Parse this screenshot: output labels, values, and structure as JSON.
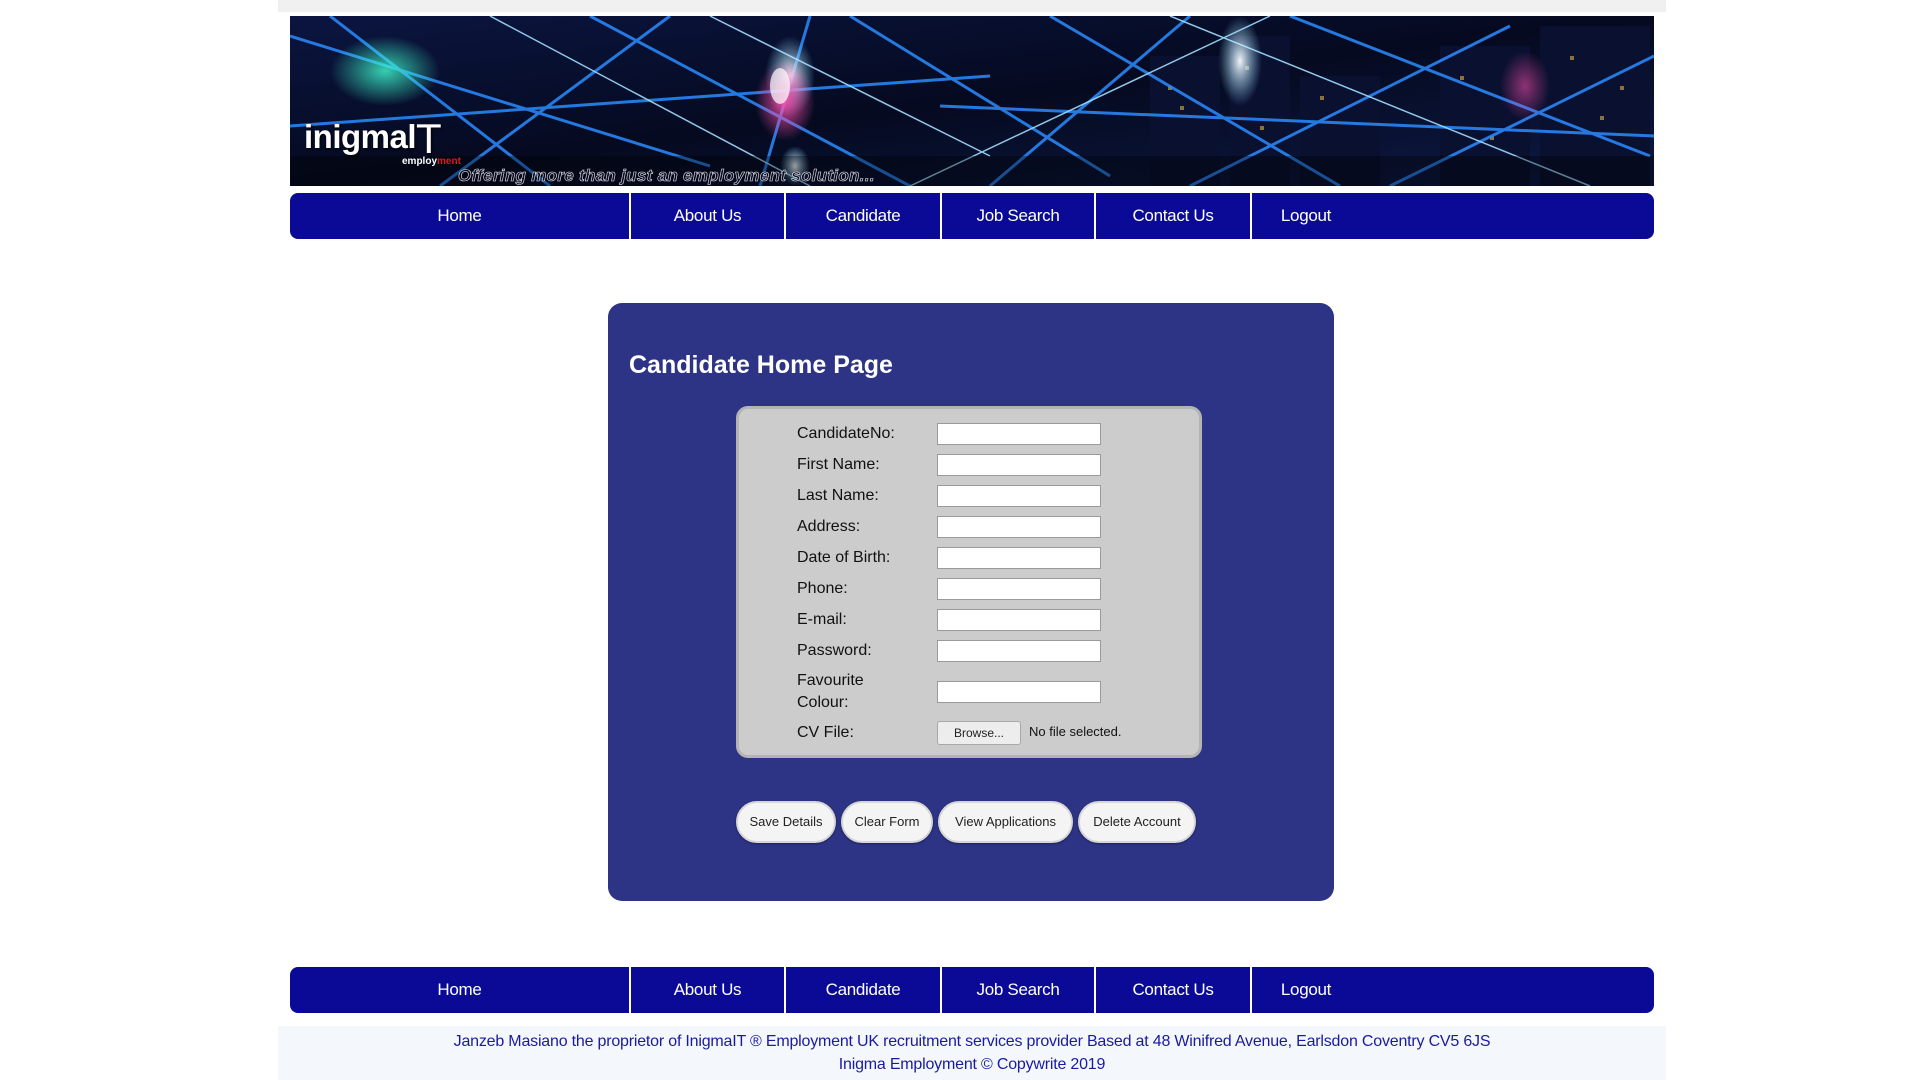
{
  "site": {
    "logo_main": "inigmal",
    "logo_it": "T",
    "logo_sub": "employ",
    "logo_sub_red": "ment",
    "tagline": "Offering more than just an employment solution..."
  },
  "nav": {
    "items": [
      "Home",
      "About Us",
      "Candidate",
      "Job Search",
      "Contact Us",
      "Logout"
    ]
  },
  "panel": {
    "title": "Candidate Home Page"
  },
  "form": {
    "fields": [
      {
        "label": "CandidateNo:",
        "value": ""
      },
      {
        "label": "First Name:",
        "value": ""
      },
      {
        "label": "Last Name:",
        "value": ""
      },
      {
        "label": "Address:",
        "value": ""
      },
      {
        "label": "Date of Birth:",
        "value": ""
      },
      {
        "label": "Phone:",
        "value": ""
      },
      {
        "label": "E-mail:",
        "value": ""
      },
      {
        "label": "Password:",
        "value": ""
      },
      {
        "label": "Favourite Colour:",
        "value": ""
      }
    ],
    "cv_label": "CV File:",
    "browse_label": "Browse...",
    "file_status": "No file selected."
  },
  "actions": {
    "save": "Save Details",
    "clear": "Clear Form",
    "view": "View Applications",
    "delete": "Delete Account"
  },
  "footer": {
    "line1": "Janzeb Masiano the proprietor of InigmaIT ® Employment UK recruitment services provider Based at 48 Winifred Avenue, Earlsdon Coventry CV5 6JS",
    "line2": "Inigma Employment © Copywrite 2019"
  }
}
